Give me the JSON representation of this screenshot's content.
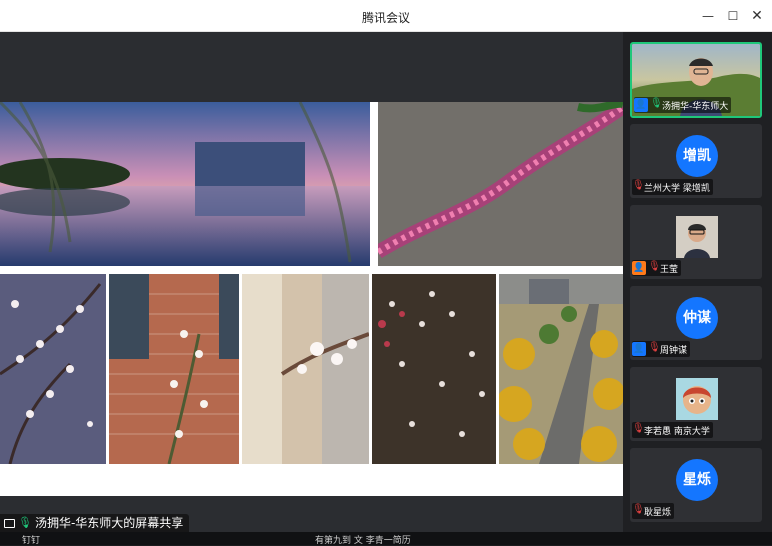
{
  "window": {
    "title": "腾讯会议"
  },
  "share": {
    "label": "汤拥华-华东师大的屏幕共享"
  },
  "participants": [
    {
      "name": "汤拥华-华东师大",
      "avatar_text": "",
      "role": "host",
      "video": true
    },
    {
      "name": "兰州大学 梁增凯",
      "avatar_text": "增凯",
      "role": "",
      "video": false
    },
    {
      "name": "王莹",
      "avatar_text": "",
      "role": "cohost",
      "video": false
    },
    {
      "name": "周钟谋",
      "avatar_text": "仲谋",
      "role": "host",
      "video": false
    },
    {
      "name": "李若愚 南京大学",
      "avatar_text": "",
      "role": "",
      "video": false
    },
    {
      "name": "耿星烁",
      "avatar_text": "星烁",
      "role": "",
      "video": false
    }
  ],
  "bottom": {
    "left_text": "钉钉",
    "center_text": "有第九到 文 李青一简历"
  },
  "colors": {
    "accent": "#1476ff",
    "active_border": "#1fc77a",
    "cohost": "#ff7a1a"
  }
}
